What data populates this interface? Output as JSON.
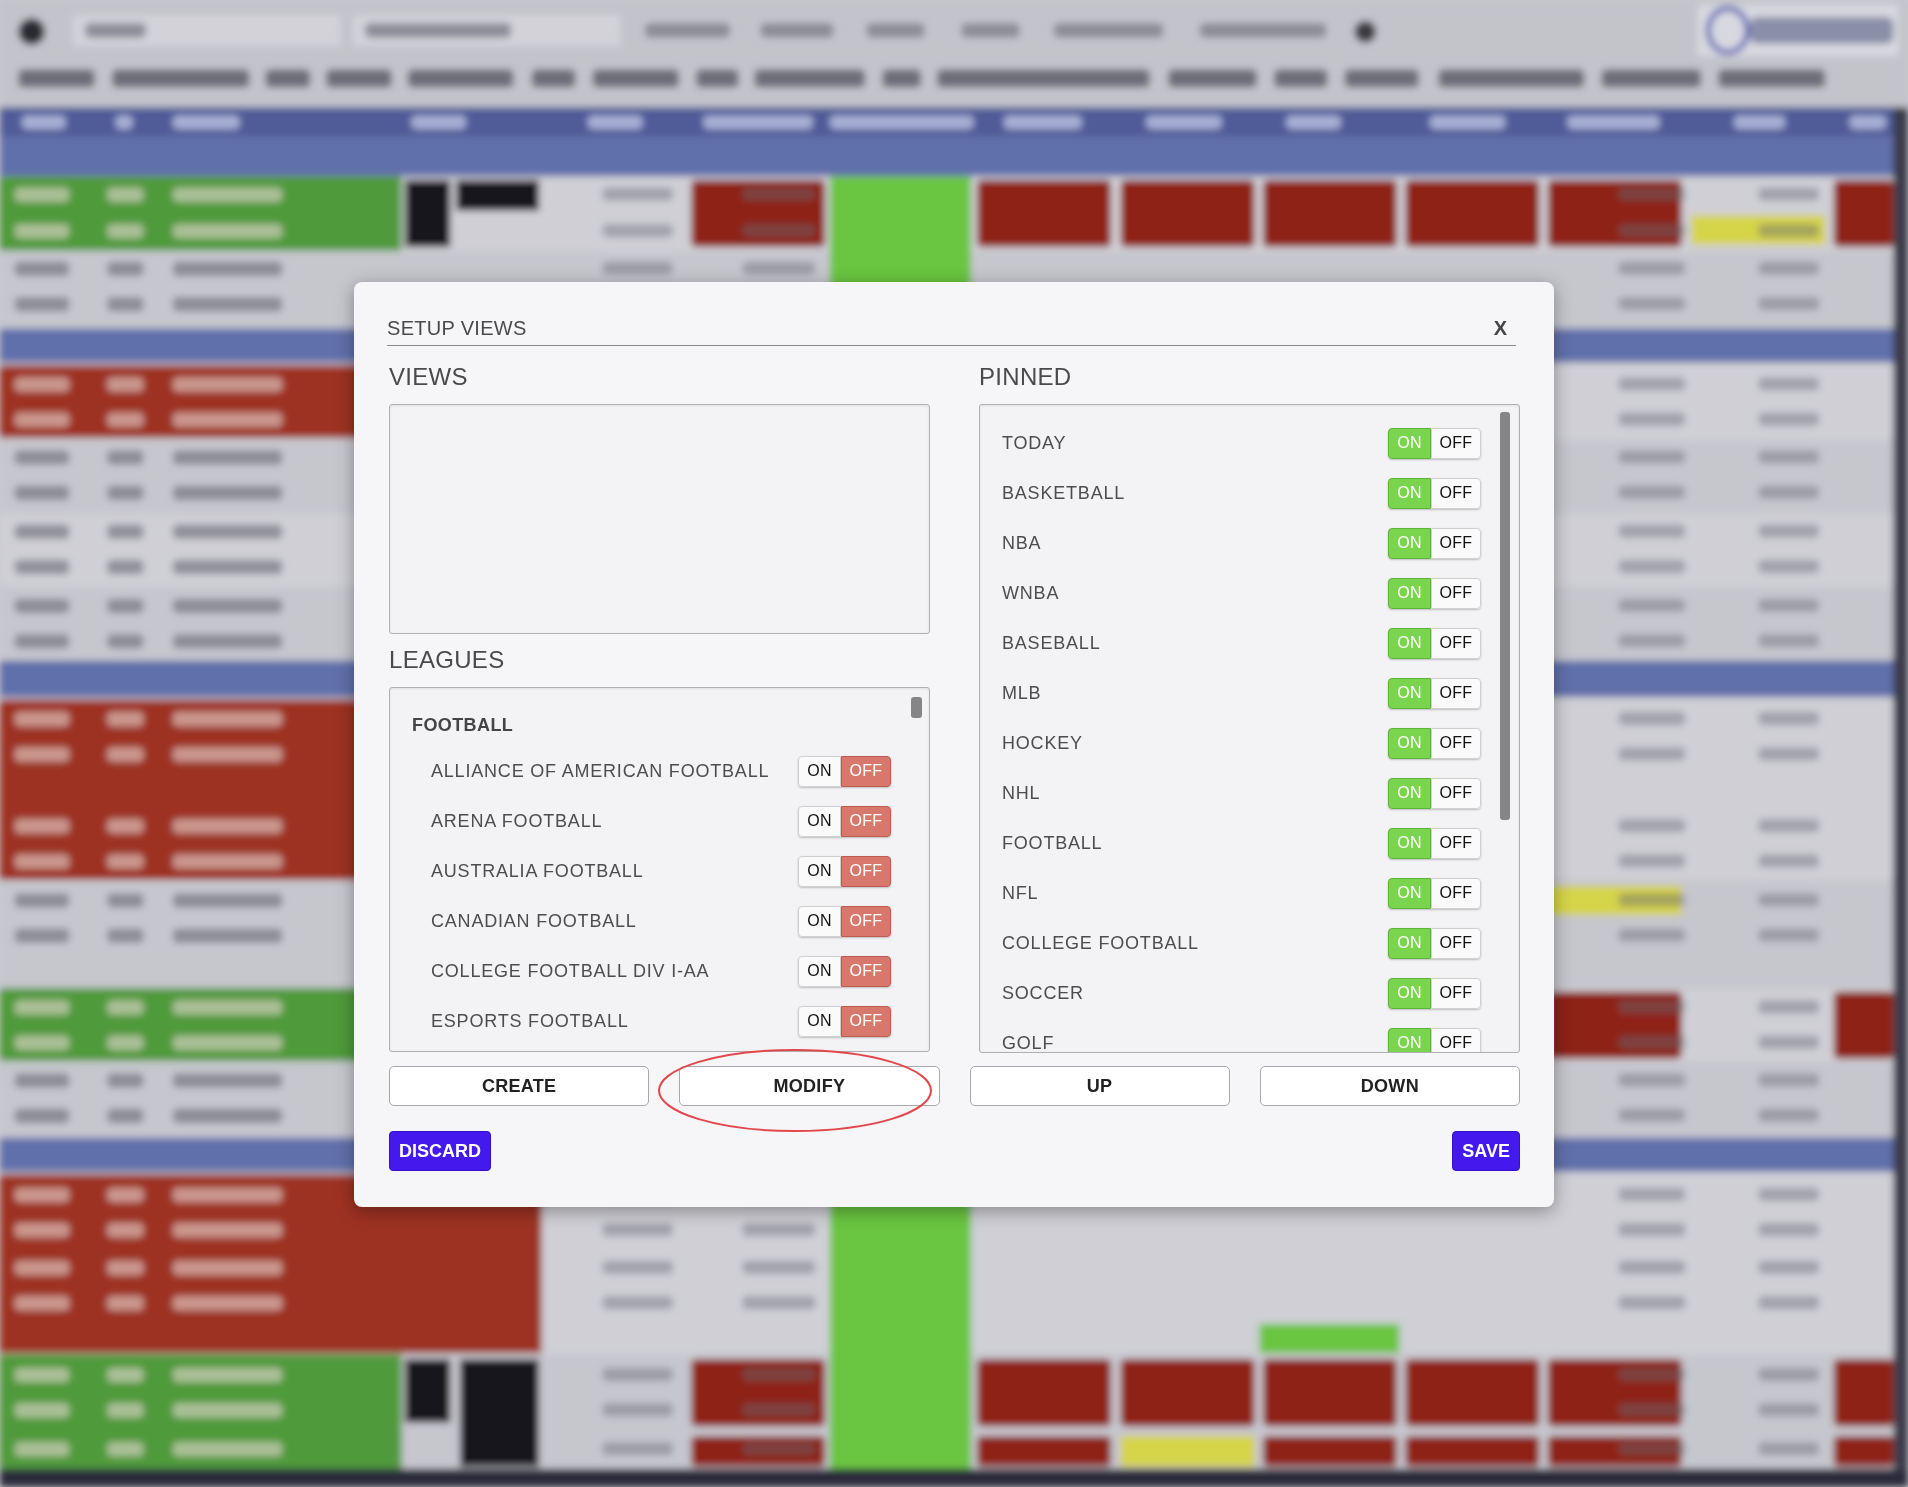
{
  "dialog": {
    "title": "SETUP VIEWS",
    "close_label": "X"
  },
  "views": {
    "heading": "VIEWS"
  },
  "leagues": {
    "heading": "LEAGUES",
    "groups": [
      {
        "label": "FOOTBALL",
        "items": [
          {
            "label": "ALLIANCE OF AMERICAN FOOTBALL",
            "on": false,
            "on_label": "ON",
            "off_label": "OFF"
          },
          {
            "label": "ARENA FOOTBALL",
            "on": false,
            "on_label": "ON",
            "off_label": "OFF"
          },
          {
            "label": "AUSTRALIA FOOTBALL",
            "on": false,
            "on_label": "ON",
            "off_label": "OFF"
          },
          {
            "label": "CANADIAN FOOTBALL",
            "on": false,
            "on_label": "ON",
            "off_label": "OFF"
          },
          {
            "label": "COLLEGE FOOTBALL DIV I-AA",
            "on": false,
            "on_label": "ON",
            "off_label": "OFF"
          },
          {
            "label": "ESPORTS FOOTBALL",
            "on": false,
            "on_label": "ON",
            "off_label": "OFF"
          }
        ]
      }
    ]
  },
  "pinned": {
    "heading": "PINNED",
    "items": [
      {
        "label": "TODAY",
        "on": true,
        "on_label": "ON",
        "off_label": "OFF"
      },
      {
        "label": "BASKETBALL",
        "on": true,
        "on_label": "ON",
        "off_label": "OFF"
      },
      {
        "label": "NBA",
        "on": true,
        "on_label": "ON",
        "off_label": "OFF"
      },
      {
        "label": "WNBA",
        "on": true,
        "on_label": "ON",
        "off_label": "OFF"
      },
      {
        "label": "BASEBALL",
        "on": true,
        "on_label": "ON",
        "off_label": "OFF"
      },
      {
        "label": "MLB",
        "on": true,
        "on_label": "ON",
        "off_label": "OFF"
      },
      {
        "label": "HOCKEY",
        "on": true,
        "on_label": "ON",
        "off_label": "OFF"
      },
      {
        "label": "NHL",
        "on": true,
        "on_label": "ON",
        "off_label": "OFF"
      },
      {
        "label": "FOOTBALL",
        "on": true,
        "on_label": "ON",
        "off_label": "OFF"
      },
      {
        "label": "NFL",
        "on": true,
        "on_label": "ON",
        "off_label": "OFF"
      },
      {
        "label": "COLLEGE FOOTBALL",
        "on": true,
        "on_label": "ON",
        "off_label": "OFF"
      },
      {
        "label": "SOCCER",
        "on": true,
        "on_label": "ON",
        "off_label": "OFF"
      },
      {
        "label": "GOLF",
        "on": true,
        "on_label": "ON",
        "off_label": "OFF"
      }
    ]
  },
  "buttons": [
    {
      "label": "CREATE",
      "highlighted": false
    },
    {
      "label": "MODIFY",
      "highlighted": true
    },
    {
      "label": "UP",
      "highlighted": false
    },
    {
      "label": "DOWN",
      "highlighted": false
    }
  ],
  "actions": [
    {
      "label": "DISCARD"
    },
    {
      "label": "SAVE"
    }
  ]
}
